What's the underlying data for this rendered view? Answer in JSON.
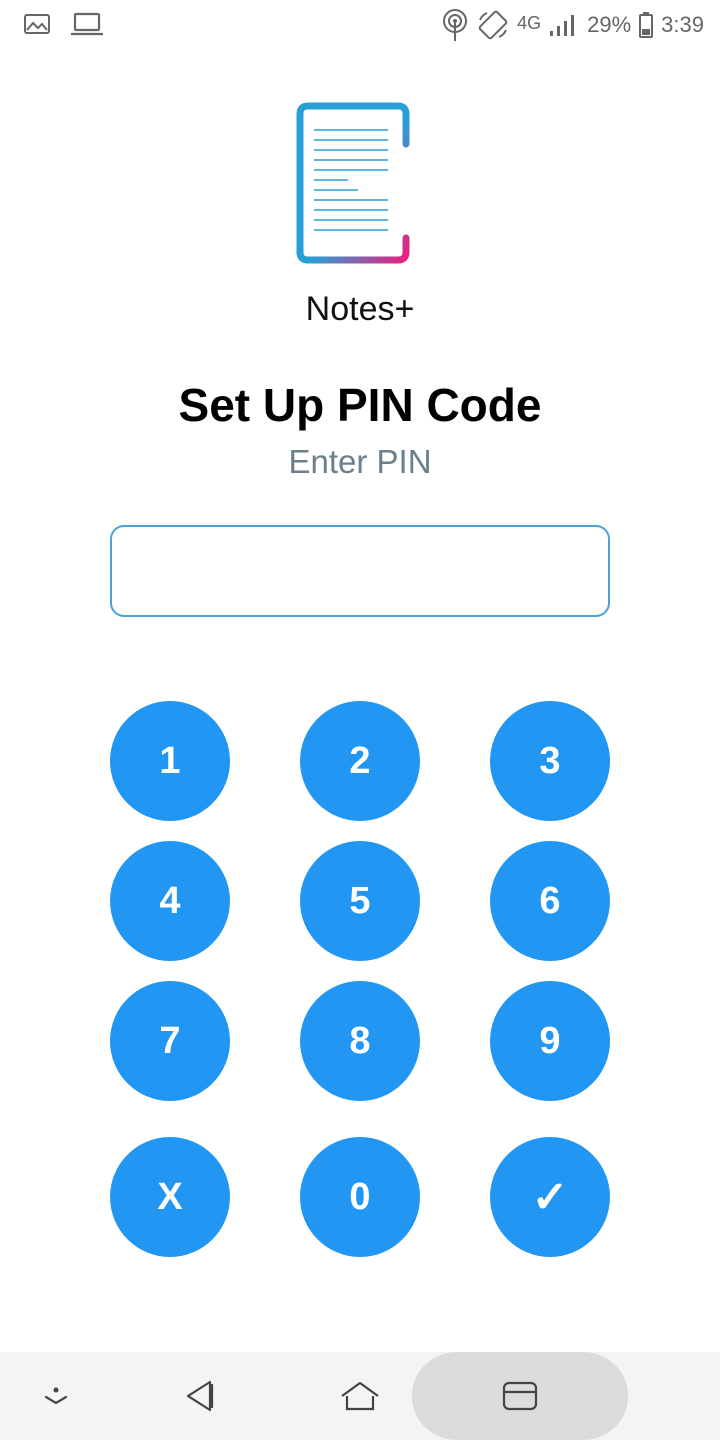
{
  "status_bar": {
    "left_icons": [
      "image-icon",
      "laptop-icon"
    ],
    "right_icons": [
      "hotspot-icon",
      "rotate-icon",
      "signal-icon",
      "battery-icon"
    ],
    "network": "4G",
    "battery": "29%",
    "time": "3:39"
  },
  "app": {
    "name": "Notes+",
    "logo_icon": "notes-plus-logo-icon"
  },
  "setup": {
    "title": "Set Up PIN Code",
    "subtitle": "Enter PIN",
    "pin_value": "",
    "pin_placeholder": ""
  },
  "keypad": {
    "keys": [
      "1",
      "2",
      "3",
      "4",
      "5",
      "6",
      "7",
      "8",
      "9",
      "X",
      "0",
      "✓"
    ]
  },
  "nav_bar": {
    "icons": [
      "chevron-down-icon",
      "back-icon",
      "home-icon",
      "recents-icon"
    ]
  },
  "colors": {
    "accent": "#2196f3",
    "input_border": "#4aa3df",
    "subtitle": "#6b7f8c",
    "logo_gradient_start": "#2a9fd6",
    "logo_gradient_end": "#e8207e"
  }
}
